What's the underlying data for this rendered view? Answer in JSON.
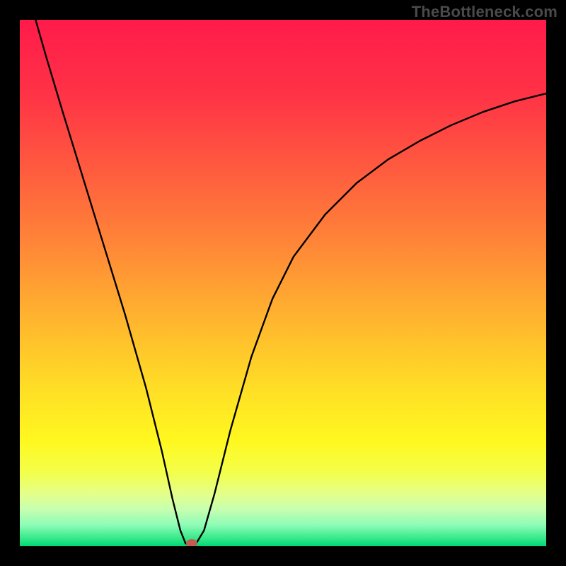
{
  "watermark": "TheBottleneck.com",
  "chart_data": {
    "type": "line",
    "title": "",
    "xlabel": "",
    "ylabel": "",
    "xlim": [
      0,
      100
    ],
    "ylim": [
      0,
      100
    ],
    "series": [
      {
        "name": "bottleneck-curve",
        "x": [
          3,
          5,
          8,
          12,
          16,
          20,
          24,
          27,
          29,
          30.5,
          31.5,
          33.5,
          35,
          37,
          40,
          44,
          48,
          52,
          58,
          64,
          70,
          76,
          82,
          88,
          94,
          100
        ],
        "y": [
          100,
          93,
          83,
          70,
          57,
          44,
          30,
          18,
          9,
          3,
          0.5,
          0.5,
          3,
          10,
          22,
          36,
          47,
          55,
          63,
          69,
          73.5,
          77,
          80,
          82.5,
          84.5,
          86
        ]
      }
    ],
    "marker": {
      "x": 32.7,
      "y": 0.5
    },
    "gradient_stops": [
      {
        "offset": 0.0,
        "color": "#ff1b4a"
      },
      {
        "offset": 0.14,
        "color": "#ff3246"
      },
      {
        "offset": 0.28,
        "color": "#ff5a3f"
      },
      {
        "offset": 0.42,
        "color": "#ff8438"
      },
      {
        "offset": 0.56,
        "color": "#ffb22f"
      },
      {
        "offset": 0.7,
        "color": "#ffde26"
      },
      {
        "offset": 0.8,
        "color": "#fff81f"
      },
      {
        "offset": 0.86,
        "color": "#f3ff4a"
      },
      {
        "offset": 0.9,
        "color": "#e4ff8a"
      },
      {
        "offset": 0.93,
        "color": "#c7ffb0"
      },
      {
        "offset": 0.96,
        "color": "#8dfcb6"
      },
      {
        "offset": 0.985,
        "color": "#36e989"
      },
      {
        "offset": 1.0,
        "color": "#00d977"
      }
    ]
  }
}
